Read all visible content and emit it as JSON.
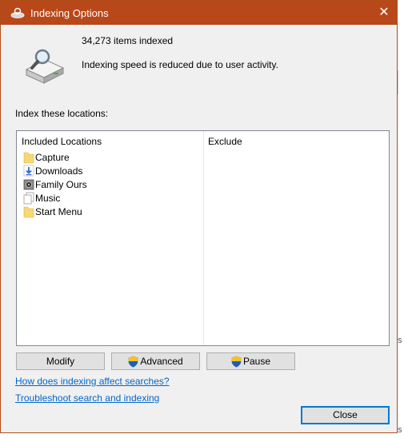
{
  "window": {
    "title": "Indexing Options",
    "close_glyph": "✕"
  },
  "status": {
    "items_indexed": "34,273 items indexed",
    "message": "Indexing speed is reduced due to user activity."
  },
  "locations_label": "Index these locations:",
  "table": {
    "headers": {
      "included": "Included Locations",
      "exclude": "Exclude"
    },
    "rows": [
      {
        "label": "Capture",
        "icon": "folder-icon"
      },
      {
        "label": "Downloads",
        "icon": "downloads-icon"
      },
      {
        "label": "Family Ours",
        "icon": "drive-icon"
      },
      {
        "label": "Music",
        "icon": "library-icon"
      },
      {
        "label": "Start Menu",
        "icon": "folder-icon"
      }
    ]
  },
  "buttons": {
    "modify": "Modify",
    "advanced": "Advanced",
    "pause": "Pause",
    "close": "Close"
  },
  "links": {
    "how_indexing": "How does indexing affect searches?",
    "troubleshoot": "Troubleshoot search and indexing"
  },
  "background_edge": {
    "char_top": "s",
    "char_bottom": "s"
  },
  "colors": {
    "titlebar": "#b8481a",
    "link": "#0066cc",
    "dialog_bg": "#f0f0f0"
  }
}
